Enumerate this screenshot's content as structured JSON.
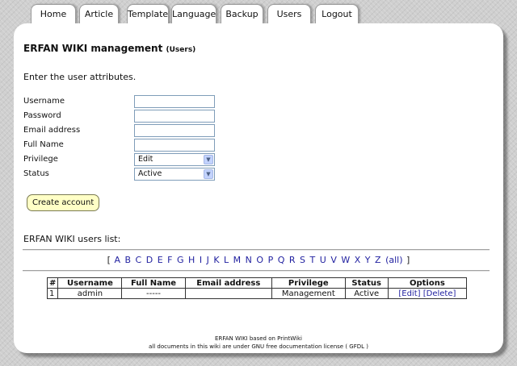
{
  "nav": {
    "tabs": [
      {
        "label": "Home"
      },
      {
        "label": "Article"
      },
      {
        "label": "Template"
      },
      {
        "label": "Language"
      },
      {
        "label": "Backup"
      },
      {
        "label": "Users"
      },
      {
        "label": "Logout"
      }
    ]
  },
  "page": {
    "title": "ERFAN WIKI management",
    "title_suffix": "(Users)",
    "intro": "Enter the user attributes."
  },
  "form": {
    "username_label": "Username",
    "username_value": "",
    "password_label": "Password",
    "password_value": "",
    "email_label": "Email address",
    "email_value": "",
    "fullname_label": "Full Name",
    "fullname_value": "",
    "privilege_label": "Privilege",
    "privilege_value": "Edit",
    "status_label": "Status",
    "status_value": "Active",
    "create_button": "Create account"
  },
  "users_list": {
    "title": "ERFAN WIKI users list:",
    "open_bracket": "[",
    "close_bracket": "]",
    "letters": [
      "A",
      "B",
      "C",
      "D",
      "E",
      "F",
      "G",
      "H",
      "I",
      "J",
      "K",
      "L",
      "M",
      "N",
      "O",
      "P",
      "Q",
      "R",
      "S",
      "T",
      "U",
      "V",
      "W",
      "X",
      "Y",
      "Z"
    ],
    "all_label": "(all)",
    "columns": [
      "#",
      "Username",
      "Full Name",
      "Email address",
      "Privilege",
      "Status",
      "Options"
    ],
    "rows": [
      {
        "num": "1",
        "username": "admin",
        "full_name": "-----",
        "email": "",
        "privilege": "Management",
        "status": "Active",
        "edit": "[Edit]",
        "delete": "[Delete]"
      }
    ]
  },
  "footer": {
    "line1": "ERFAN WIKI based on PrintWiki",
    "line2": "all documents in this wiki are under GNU free documentation license ( GFDL )"
  }
}
